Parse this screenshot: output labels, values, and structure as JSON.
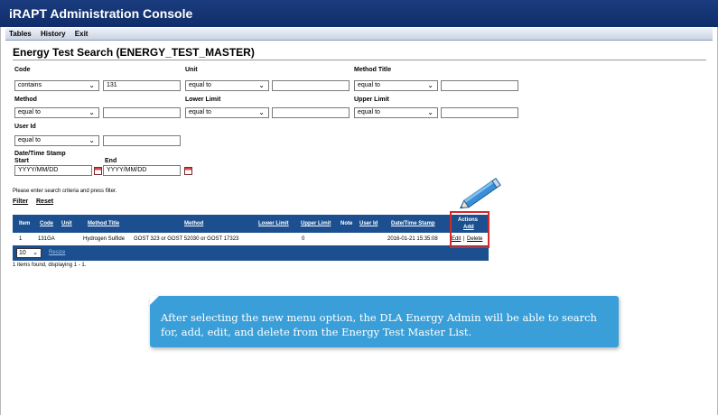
{
  "app": {
    "title": "iRAPT Administration Console"
  },
  "menu": [
    "Tables",
    "History",
    "Exit"
  ],
  "page": {
    "title": "Energy Test Search (ENERGY_TEST_MASTER)"
  },
  "form": {
    "code": {
      "label": "Code",
      "operator": "contains",
      "value": "131"
    },
    "unit": {
      "label": "Unit",
      "operator": "equal to",
      "value": ""
    },
    "method_title": {
      "label": "Method Title",
      "operator": "equal to",
      "value": ""
    },
    "method": {
      "label": "Method",
      "operator": "equal to",
      "value": ""
    },
    "lower_limit": {
      "label": "Lower Limit",
      "operator": "equal to",
      "value": ""
    },
    "upper_limit": {
      "label": "Upper Limit",
      "operator": "equal to",
      "value": ""
    },
    "user_id": {
      "label": "User Id",
      "operator": "equal to",
      "value": ""
    },
    "date_time": {
      "label": "Date/Time Stamp",
      "start_label": "Start",
      "end_label": "End",
      "start_placeholder": "YYYY/MM/DD",
      "end_placeholder": "YYYY/MM/DD"
    },
    "instructions": "Please enter search criteria and press filter.",
    "filter_label": "Filter",
    "reset_label": "Reset"
  },
  "grid": {
    "headers": {
      "item": "Item",
      "code": "Code",
      "unit": "Unit",
      "method_title": "Method Title",
      "method": "Method",
      "lower_limit": "Lower Limit",
      "upper_limit": "Upper Limit",
      "note": "Note",
      "user_id": "User Id",
      "date_time": "Date/Time Stamp",
      "actions": "Actions",
      "add": "Add"
    },
    "rows": [
      {
        "item": "1",
        "code": "131GA",
        "unit": "",
        "method_title": "Hydrogen Sulfide",
        "method": "GOST 323 or GOST 52030 or GOST 17323",
        "lower_limit": "",
        "upper_limit": "0",
        "note": "",
        "user_id": "",
        "date_time": "2016-01-21 15:35:08",
        "edit": "Edit",
        "separator": "|",
        "delete": "Delete"
      }
    ],
    "page_size": "10",
    "resize_label": "Resize",
    "count_text": "1 items found, displaying 1 - 1."
  },
  "callout": {
    "text": "After selecting the new menu option, the DLA Energy Admin will be able to search for, add, edit, and delete from the Energy Test Master List."
  },
  "colors": {
    "titlebar": "#1a3c7e",
    "grid_header": "#1b4f8f",
    "callout": "#3a9fd8",
    "highlight": "#d62a2a"
  },
  "icons": [
    "calendar-icon",
    "pencil-icon",
    "chevron-down-icon"
  ]
}
